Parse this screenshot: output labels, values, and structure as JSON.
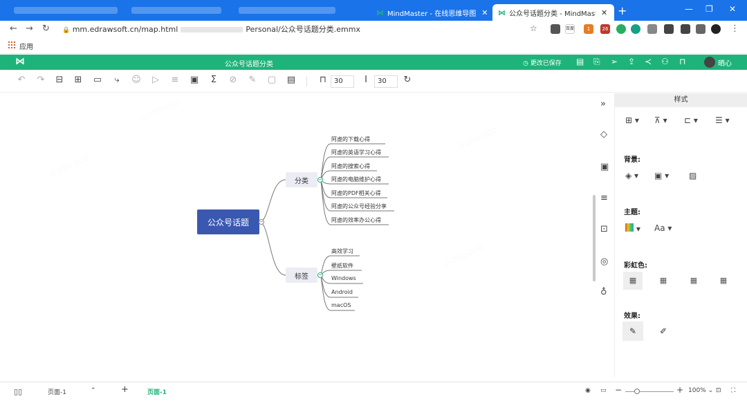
{
  "browser": {
    "tabs": [
      {
        "label": "MindMaster - 在线思维导图"
      },
      {
        "label": "公众号话题分类 - MindMaster在"
      }
    ],
    "url_prefix": "mm.edrawsoft.cn/map.html",
    "url_suffix": "Personal/公众号话题分类.emmx",
    "bookmarks_label": "应用",
    "ext_labels": {
      "baidu": "百度",
      "badge1": "1",
      "badge26": "26"
    }
  },
  "app": {
    "logo": "⋈",
    "doc_title": "公众号话题分类",
    "saved_status": "更改已保存",
    "user_name": "晒心"
  },
  "toolbar": {
    "spacing_h": "30",
    "spacing_v": "30"
  },
  "mindmap": {
    "root": "公众号话题",
    "branches": [
      {
        "label": "分类",
        "children": [
          "阿虚的下载心得",
          "阿虚的英语学习心得",
          "阿虚的搜索心得",
          "阿虚的电脑维护心得",
          "阿虚的PDF相关心得",
          "阿虚的公众号经验分享",
          "阿虚的效率办公心得"
        ]
      },
      {
        "label": "标签",
        "children": [
          "高效学习",
          "壁纸软件",
          "Windows",
          "Android",
          "macOS"
        ]
      }
    ]
  },
  "panel": {
    "title": "样式",
    "background_label": "背景:",
    "theme_label": "主题:",
    "theme_font": "Aa",
    "rainbow_label": "彩虹色:",
    "effect_label": "效果:"
  },
  "bottombar": {
    "page_select": "页面-1",
    "add": "+",
    "active_page": "页面-1",
    "zoom": "100%"
  },
  "colors": {
    "brand": "#1eb37a",
    "root_node": "#3a58b0",
    "chrome_blue": "#1a73e8"
  }
}
